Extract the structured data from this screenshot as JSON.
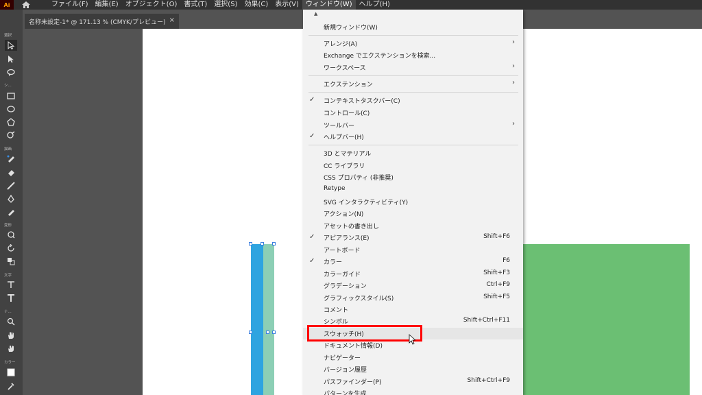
{
  "app": {
    "logo": "Ai",
    "menus": [
      "ファイル(F)",
      "編集(E)",
      "オブジェクト(O)",
      "書式(T)",
      "選択(S)",
      "効果(C)",
      "表示(V)",
      "ウィンドウ(W)",
      "ヘルプ(H)"
    ],
    "active_menu": "ウィンドウ(W)"
  },
  "document_tab": {
    "title": "名称未設定-1* @ 171.13 % (CMYK/プレビュー)",
    "close": "×"
  },
  "toolbar": {
    "labels": [
      "選択",
      "シ...",
      "描画",
      "変形",
      "文字",
      "ナ...",
      "カラー"
    ]
  },
  "dropdown": {
    "items": [
      {
        "label": "新規ウィンドウ(W)",
        "check": "",
        "shortcut": "",
        "submenu": false
      },
      {
        "label": "アレンジ(A)",
        "check": "",
        "shortcut": "",
        "submenu": true
      },
      {
        "label": "Exchange でエクステンションを検索...",
        "check": "",
        "shortcut": "",
        "submenu": false
      },
      {
        "label": "ワークスペース",
        "check": "",
        "shortcut": "",
        "submenu": true
      },
      {
        "label": "エクステンション",
        "check": "",
        "shortcut": "",
        "submenu": true
      },
      {
        "label": "コンテキストタスクバー(C)",
        "check": "✓",
        "shortcut": "",
        "submenu": false
      },
      {
        "label": "コントロール(C)",
        "check": "",
        "shortcut": "",
        "submenu": false
      },
      {
        "label": "ツールバー",
        "check": "",
        "shortcut": "",
        "submenu": true
      },
      {
        "label": "ヘルプバー(H)",
        "check": "✓",
        "shortcut": "",
        "submenu": false
      },
      {
        "label": "3D とマテリアル",
        "check": "",
        "shortcut": "",
        "submenu": false
      },
      {
        "label": "CC ライブラリ",
        "check": "",
        "shortcut": "",
        "submenu": false
      },
      {
        "label": "CSS プロパティ (非推奨)",
        "check": "",
        "shortcut": "",
        "submenu": false
      },
      {
        "label": "Retype",
        "check": "",
        "shortcut": "",
        "submenu": false
      },
      {
        "label": "SVG インタラクティビティ(Y)",
        "check": "",
        "shortcut": "",
        "submenu": false
      },
      {
        "label": "アクション(N)",
        "check": "",
        "shortcut": "",
        "submenu": false
      },
      {
        "label": "アセットの書き出し",
        "check": "",
        "shortcut": "",
        "submenu": false
      },
      {
        "label": "アピアランス(E)",
        "check": "✓",
        "shortcut": "Shift+F6",
        "submenu": false
      },
      {
        "label": "アートボード",
        "check": "",
        "shortcut": "",
        "submenu": false
      },
      {
        "label": "カラー",
        "check": "✓",
        "shortcut": "F6",
        "submenu": false
      },
      {
        "label": "カラーガイド",
        "check": "",
        "shortcut": "Shift+F3",
        "submenu": false
      },
      {
        "label": "グラデーション",
        "check": "",
        "shortcut": "Ctrl+F9",
        "submenu": false
      },
      {
        "label": "グラフィックスタイル(S)",
        "check": "",
        "shortcut": "Shift+F5",
        "submenu": false
      },
      {
        "label": "コメント",
        "check": "",
        "shortcut": "",
        "submenu": false
      },
      {
        "label": "シンボル",
        "check": "",
        "shortcut": "Shift+Ctrl+F11",
        "submenu": false
      },
      {
        "label": "スウォッチ(H)",
        "check": "",
        "shortcut": "",
        "submenu": false
      },
      {
        "label": "ドキュメント情報(D)",
        "check": "",
        "shortcut": "",
        "submenu": false
      },
      {
        "label": "ナビゲーター",
        "check": "",
        "shortcut": "",
        "submenu": false
      },
      {
        "label": "バージョン履歴",
        "check": "",
        "shortcut": "",
        "submenu": false
      },
      {
        "label": "パスファインダー(P)",
        "check": "",
        "shortcut": "Shift+Ctrl+F9",
        "submenu": false
      },
      {
        "label": "パターンを生成",
        "check": "",
        "shortcut": "",
        "submenu": false
      }
    ],
    "highlighted": "スウォッチ(H)"
  },
  "colors": {
    "menubar": "#323232",
    "dropdown_bg": "#f2f2f2",
    "highlight_box": "#ff0000",
    "green_rect": "#6bbf73",
    "blue_bar": "#2ea4e0",
    "teal_bar": "#8ccfb5"
  }
}
